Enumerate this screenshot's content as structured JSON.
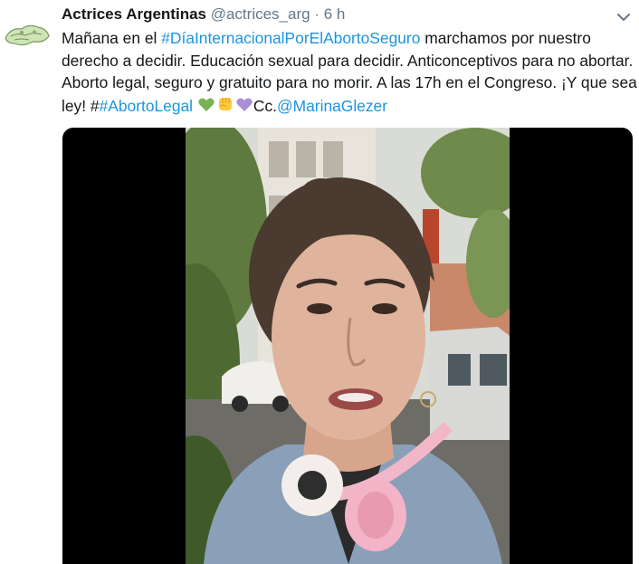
{
  "tweet": {
    "author_name": "Actrices Argentinas",
    "handle": "@actrices_arg",
    "separator": "·",
    "time": "6 h",
    "text_1": "Mañana en el ",
    "hashtag_1": "#DíaInternacionalPorElAbortoSeguro",
    "text_2": " marchamos por nuestro derecho a decidir. Educación sexual para decidir. Anticonceptivos para no abortar. Aborto legal, seguro y gratuito para no morir. A las 17h en el Congreso. ¡Y que sea ley! #",
    "hashtag_2": "#AbortoLegal",
    "text_3": " ",
    "text_4": "Cc.",
    "mention": "@MarinaGlezer"
  },
  "colors": {
    "link": "#1b95e0",
    "muted": "#657786",
    "text": "#14171a",
    "green_heart": "#77b255",
    "purple_heart": "#aa8ed6",
    "fist": "#ffc83d"
  },
  "icons": {
    "avatar": "actrices-logo-icon",
    "menu": "chevron-down-icon",
    "emoji_1": "green-heart-icon",
    "emoji_2": "raised-fist-icon",
    "emoji_3": "purple-heart-icon"
  },
  "media": {
    "type": "video",
    "subject": "woman speaking outdoors with pink headphones around her neck"
  }
}
